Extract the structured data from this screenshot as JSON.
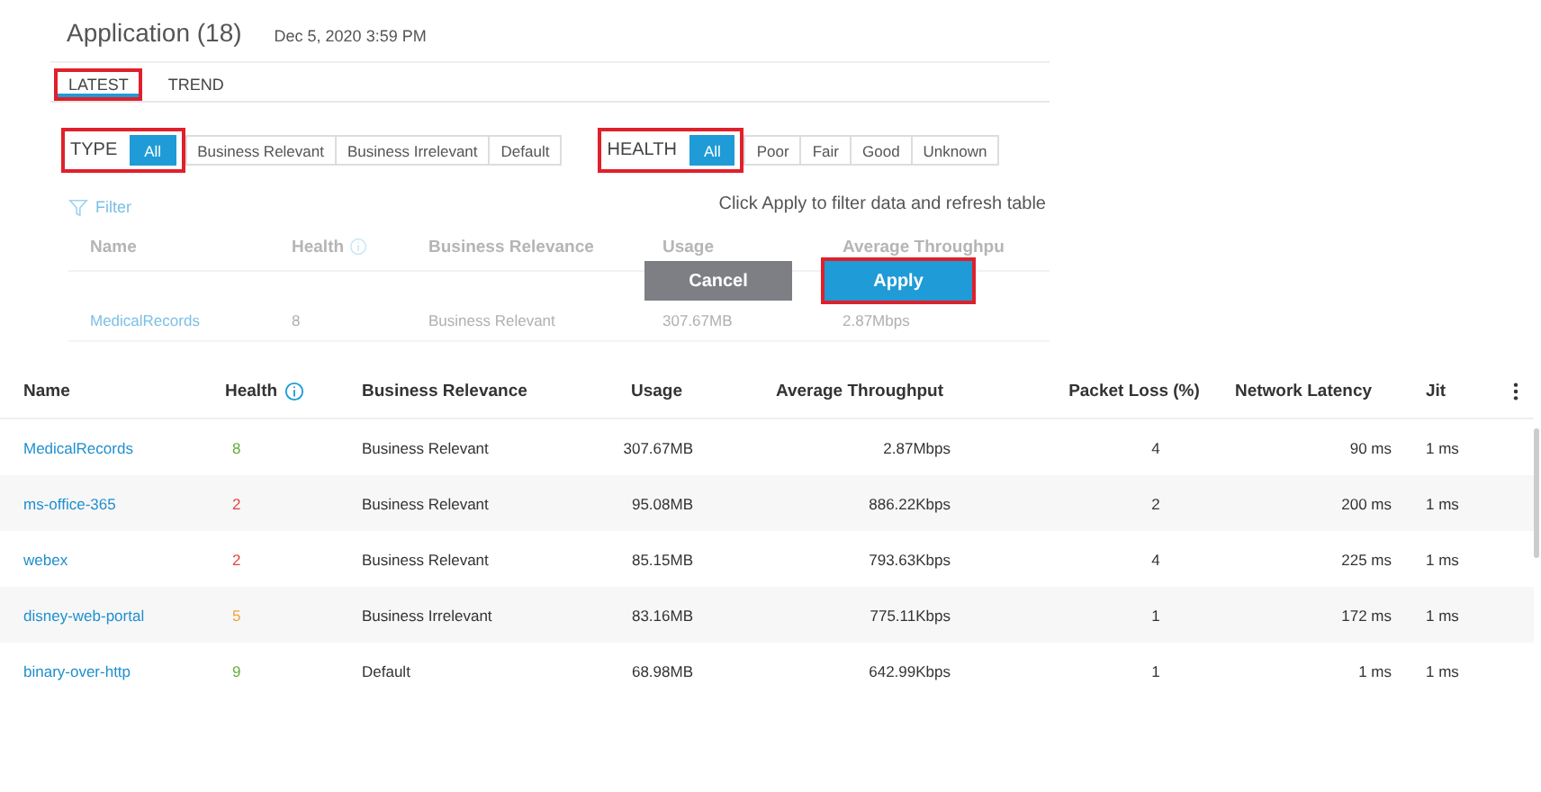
{
  "header": {
    "title": "Application (18)",
    "timestamp": "Dec 5, 2020 3:59 PM"
  },
  "tabs": [
    {
      "label": "LATEST",
      "selected": true,
      "highlighted": true
    },
    {
      "label": "TREND",
      "selected": false,
      "highlighted": false
    }
  ],
  "filters": [
    {
      "label": "TYPE",
      "highlighted": true,
      "options": [
        {
          "label": "All",
          "selected": true
        },
        {
          "label": "Business Relevant",
          "selected": false
        },
        {
          "label": "Business Irrelevant",
          "selected": false
        },
        {
          "label": "Default",
          "selected": false
        }
      ]
    },
    {
      "label": "HEALTH",
      "highlighted": true,
      "options": [
        {
          "label": "All",
          "selected": true
        },
        {
          "label": "Poor",
          "selected": false
        },
        {
          "label": "Fair",
          "selected": false
        },
        {
          "label": "Good",
          "selected": false
        },
        {
          "label": "Unknown",
          "selected": false
        }
      ]
    }
  ],
  "background_table": {
    "filter_label": "Filter",
    "columns": [
      "Name",
      "Health",
      "Business Relevance",
      "Usage",
      "Average Throughpu"
    ],
    "row": [
      "MedicalRecords",
      "8",
      "Business Relevant",
      "307.67MB",
      "2.87Mbps"
    ]
  },
  "overlay": {
    "message": "Click Apply to filter data and refresh table",
    "buttons": [
      {
        "label": "Cancel",
        "kind": "secondary",
        "highlighted": false
      },
      {
        "label": "Apply",
        "kind": "primary",
        "highlighted": true
      }
    ]
  },
  "table": {
    "columns": [
      {
        "label": "Name",
        "info": false
      },
      {
        "label": "Health",
        "info": true
      },
      {
        "label": "Business Relevance",
        "info": false
      },
      {
        "label": "Usage",
        "info": false
      },
      {
        "label": "Average Throughput",
        "info": false
      },
      {
        "label": "Packet Loss (%)",
        "info": false
      },
      {
        "label": "Network Latency",
        "info": false
      },
      {
        "label": "Jit",
        "info": false
      }
    ],
    "rows": [
      {
        "name": "MedicalRecords",
        "health": "8",
        "color": "#6aab3c",
        "relevance": "Business Relevant",
        "usage": "307.67MB",
        "throughput": "2.87Mbps",
        "loss": "4",
        "latency": "90 ms",
        "jitter": "1 ms"
      },
      {
        "name": "ms-office-365",
        "health": "2",
        "color": "#e2413a",
        "relevance": "Business Relevant",
        "usage": "95.08MB",
        "throughput": "886.22Kbps",
        "loss": "2",
        "latency": "200 ms",
        "jitter": "1 ms"
      },
      {
        "name": "webex",
        "health": "2",
        "color": "#e2413a",
        "relevance": "Business Relevant",
        "usage": "85.15MB",
        "throughput": "793.63Kbps",
        "loss": "4",
        "latency": "225 ms",
        "jitter": "1 ms"
      },
      {
        "name": "disney-web-portal",
        "health": "5",
        "color": "#f5a142",
        "relevance": "Business Irrelevant",
        "usage": "83.16MB",
        "throughput": "775.11Kbps",
        "loss": "1",
        "latency": "172 ms",
        "jitter": "1 ms"
      },
      {
        "name": "binary-over-http",
        "health": "9",
        "color": "#6aab3c",
        "relevance": "Default",
        "usage": "68.98MB",
        "throughput": "642.99Kbps",
        "loss": "1",
        "latency": "1 ms",
        "jitter": "1 ms"
      }
    ]
  }
}
